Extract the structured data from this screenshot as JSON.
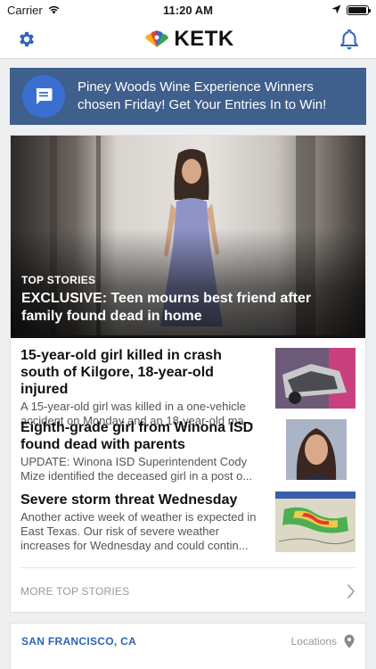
{
  "status_bar": {
    "carrier": "Carrier",
    "time": "11:20 AM",
    "battery_level": 0.95
  },
  "nav": {
    "logo_text": "KETK",
    "left_icon": "gear-icon",
    "right_icon": "bell-icon"
  },
  "alert": {
    "icon": "chat-icon",
    "text": "Piney Woods Wine Experience Winners chosen Friday! Get Your Entries In to Win!"
  },
  "hero": {
    "kicker": "TOP STORIES",
    "headline": "EXCLUSIVE: Teen mourns best friend after family found dead in home"
  },
  "stories": [
    {
      "title": "15-year-old girl killed in crash south of Kilgore, 18-year-old injured",
      "summary": "A 15-year-old girl was killed in a one-vehicle accident on Monday and an 18-year-old ma..."
    },
    {
      "title": "Eighth-grade girl from Winona ISD found dead with parents",
      "summary": "UPDATE: Winona ISD Superintendent Cody Mize identified the deceased girl in a post o..."
    },
    {
      "title": "Severe storm threat Wednesday",
      "summary": "Another active week of weather is expected in East Texas. Our risk of severe weather increases for Wednesday and could contin..."
    }
  ],
  "more": {
    "label": "MORE TOP STORIES",
    "icon": "chevron-right-icon"
  },
  "location": {
    "city": "SAN FRANCISCO, CA",
    "link_label": "Locations",
    "icon": "location-pin-icon"
  },
  "colors": {
    "accent": "#2e64b8",
    "banner": "#3f5f8c",
    "banner_icon": "#3a6fcf"
  }
}
